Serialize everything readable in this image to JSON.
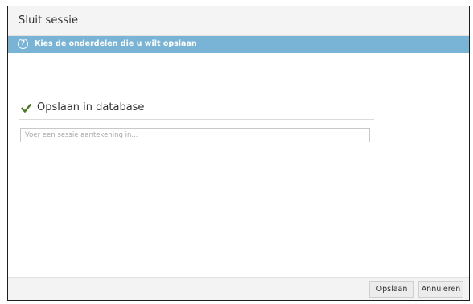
{
  "dialog": {
    "title": "Sluit sessie"
  },
  "banner": {
    "icon": "question-circle-icon",
    "icon_glyph": "?",
    "message": "Kies de onderdelen die u wilt opslaan",
    "color": "#79b4d6"
  },
  "options": {
    "save_to_database": {
      "label": "Opslaan in database",
      "checked": true,
      "check_color": "#4a7a22"
    }
  },
  "note": {
    "value": "",
    "placeholder": "Voer een sessie aantekening in..."
  },
  "footer": {
    "save_label": "Opslaan",
    "cancel_label": "Annuleren"
  }
}
